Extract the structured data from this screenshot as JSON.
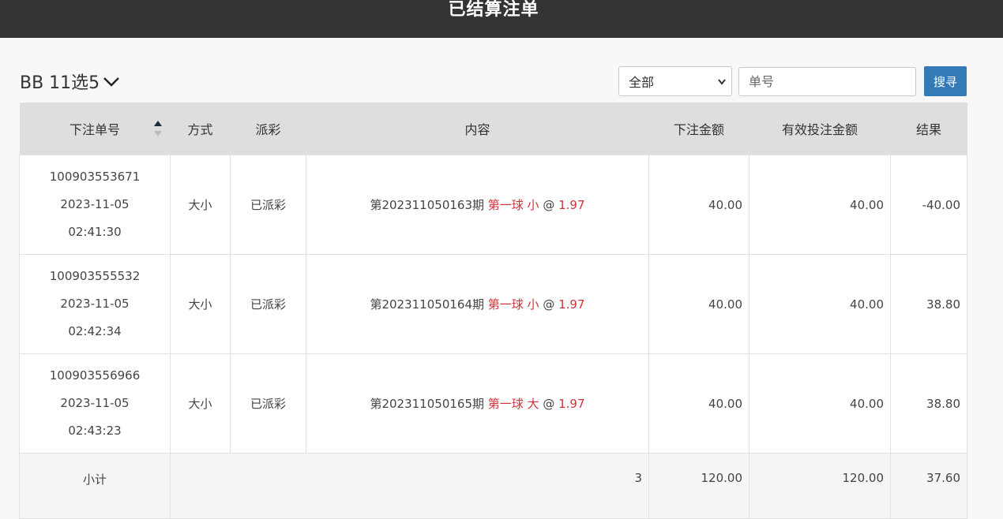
{
  "header": {
    "title": "已结算注单"
  },
  "lottery": {
    "name": "BB 11选5"
  },
  "filter": {
    "selected": "全部"
  },
  "search": {
    "placeholder": "单号",
    "button_label": "搜寻"
  },
  "table": {
    "headers": [
      "下注单号",
      "方式",
      "派彩",
      "内容",
      "下注金额",
      "有效投注金额",
      "结果"
    ],
    "rows": [
      {
        "order_no": "100903553671",
        "date": "2023-11-05",
        "time": "02:41:30",
        "method": "大小",
        "payout": "已派彩",
        "content_prefix": "第202311050163期",
        "content_pick": "第一球 小",
        "content_at": "@",
        "content_odds": "1.97",
        "bet_amount": "40.00",
        "valid_amount": "40.00",
        "result": "-40.00"
      },
      {
        "order_no": "100903555532",
        "date": "2023-11-05",
        "time": "02:42:34",
        "method": "大小",
        "payout": "已派彩",
        "content_prefix": "第202311050164期",
        "content_pick": "第一球 小",
        "content_at": "@",
        "content_odds": "1.97",
        "bet_amount": "40.00",
        "valid_amount": "40.00",
        "result": "38.80"
      },
      {
        "order_no": "100903556966",
        "date": "2023-11-05",
        "time": "02:43:23",
        "method": "大小",
        "payout": "已派彩",
        "content_prefix": "第202311050165期",
        "content_pick": "第一球 大",
        "content_at": "@",
        "content_odds": "1.97",
        "bet_amount": "40.00",
        "valid_amount": "40.00",
        "result": "38.80"
      }
    ],
    "subtotal": {
      "label": "小计",
      "count": "3",
      "bet_amount": "120.00",
      "valid_amount": "120.00",
      "result": "37.60"
    }
  },
  "colors": {
    "header_bg": "#333333",
    "table_head_bg": "#dedede",
    "accent_red": "#d0343a",
    "button_blue": "#337ab7"
  }
}
